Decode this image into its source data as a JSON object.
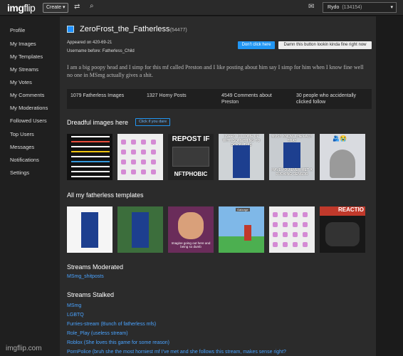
{
  "topbar": {
    "logo_main": "img",
    "logo_accent": "flip",
    "create_label": "Create ▾",
    "user_name": "Rydo",
    "user_points": "(134154)"
  },
  "sidebar": {
    "items": [
      "Profile",
      "My Images",
      "My Templates",
      "My Streams",
      "My Votes",
      "My Comments",
      "My Moderations",
      "Followed Users",
      "Top Users",
      "Messages",
      "Notifications",
      "Settings"
    ],
    "footer_logo": "imgflip.com"
  },
  "profile": {
    "username": "ZeroFrost_the_Fatherless",
    "points": "(54477)",
    "appeared": "Appeared on 420-69-21",
    "username_before": "Username before: Fatherless_Child",
    "button_primary": "Don't click here",
    "button_secondary": "Damn this button lookin kinda fine right now",
    "bio": "I am a big poopy head and I simp for this mf called Preston and I like posting about him say I simp for him when I know fine well no one in MSmg actually gives a shit."
  },
  "stats": {
    "images": "1079 Fatherless Images",
    "posts": "1327 Horny Posts",
    "comments": "4549 Comments about Preston",
    "followers": "30 people who accidentally clicked follow"
  },
  "images_section": {
    "title": "Dreadful images here",
    "button": "Click if you dare",
    "list_lines": [
      "1 - I DON'T CARE ABOUT YOUR LIFE",
      "2 - FEELS BAD WHEN",
      "3 - ...",
      "4 - DON'T ...",
      "5 - I KNOW WHO YOU ARE",
      "6 - ...",
      "7 - ...",
      "8 - YOU ARE WELL KNOWN",
      "9 - YOU ARE AN MSMG GIANT"
    ],
    "thumb3_top": "REPOST IF",
    "thumb3_bottom": "NFTPHOBIC",
    "thumb4_top": "I NEED TO COME UP WITH SOMETHING TO DO ON THIS",
    "thumb5_top": "MUST KNOW THE FACT THAT",
    "thumb5_bottom": "HAVE YOU EVER MET A FUCKING CENSOR",
    "thumb6_emoji": "🫂😭"
  },
  "templates_section": {
    "title": "All my fatherless templates",
    "thumb3_caption": "Imagine going out here and being so dumb",
    "thumb4_label": "Gaborge",
    "thumb6_text": "REACTIO"
  },
  "streams_moderated": {
    "title": "Streams Moderated",
    "items": [
      "MSmg_shitposts"
    ]
  },
  "streams_stalked": {
    "title": "Streams Stalked",
    "items": [
      "MSmg",
      "LGBTQ",
      "Furries-stream (Bunch of fatherless mfs)",
      "Role_Play (useless stream)",
      "Roblox (She loves this game for some reason)",
      "PornPolice (bruh she the most horniest mf I've met and she follows this stream, makes sense right?"
    ]
  },
  "colors": {
    "accent": "#2196f3",
    "link": "#4aa3ff",
    "background": "#2b2b2b"
  }
}
